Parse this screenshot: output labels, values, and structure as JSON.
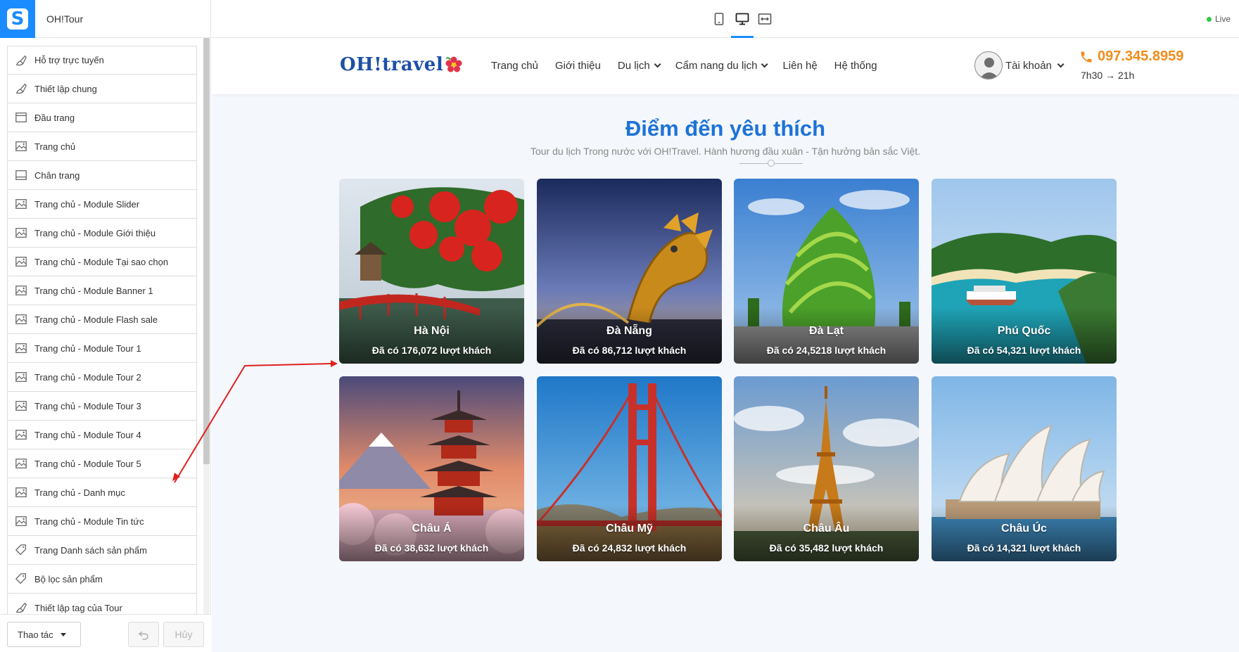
{
  "sidebar": {
    "site_name": "OH!Tour",
    "items": [
      {
        "label": "Hỗ trợ trực tuyến",
        "icon": "brush-icon"
      },
      {
        "label": "Thiết lập chung",
        "icon": "brush-icon"
      },
      {
        "label": "Đầu trang",
        "icon": "header-layout-icon"
      },
      {
        "label": "Trang chủ",
        "icon": "image-icon"
      },
      {
        "label": "Chân trang",
        "icon": "footer-layout-icon"
      },
      {
        "label": "Trang chủ - Module Slider",
        "icon": "image-icon"
      },
      {
        "label": "Trang chủ - Module Giới thiệu",
        "icon": "image-icon"
      },
      {
        "label": "Trang chủ - Module Tại sao chọn",
        "icon": "image-icon"
      },
      {
        "label": "Trang chủ - Module Banner 1",
        "icon": "image-icon"
      },
      {
        "label": "Trang chủ - Module Flash sale",
        "icon": "image-icon"
      },
      {
        "label": "Trang chủ - Module Tour 1",
        "icon": "image-icon"
      },
      {
        "label": "Trang chủ - Module Tour 2",
        "icon": "image-icon"
      },
      {
        "label": "Trang chủ - Module Tour 3",
        "icon": "image-icon"
      },
      {
        "label": "Trang chủ - Module Tour 4",
        "icon": "image-icon"
      },
      {
        "label": "Trang chủ - Module Tour 5",
        "icon": "image-icon"
      },
      {
        "label": "Trang chủ - Danh mục",
        "icon": "image-icon"
      },
      {
        "label": "Trang chủ - Module Tin tức",
        "icon": "image-icon"
      },
      {
        "label": "Trang Danh sách sản phẩm",
        "icon": "tag-icon"
      },
      {
        "label": "Bộ lọc sản phẩm",
        "icon": "tag-icon"
      },
      {
        "label": "Thiết lập tag của Tour",
        "icon": "brush-icon"
      }
    ],
    "actions_label": "Thao tác",
    "cancel_label": "Hủy"
  },
  "toolbar": {
    "live_label": "Live",
    "live_color": "#2ecc40",
    "accent": "#1a8cff"
  },
  "site": {
    "brand": "OH!travel",
    "nav": [
      {
        "label": "Trang chủ",
        "dropdown": false
      },
      {
        "label": "Giới thiệu",
        "dropdown": false
      },
      {
        "label": "Du lịch",
        "dropdown": true
      },
      {
        "label": "Cẩm nang du lịch",
        "dropdown": true
      },
      {
        "label": "Liên hệ",
        "dropdown": false
      },
      {
        "label": "Hệ thống",
        "dropdown": false
      }
    ],
    "account_label": "Tài khoản",
    "phone": "097.345.8959",
    "hours": "7h30 → 21h",
    "phone_color": "#f08c1a"
  },
  "section": {
    "title": "Điểm đến yêu thích",
    "subtitle": "Tour du lịch Trong nước với OH!Travel. Hành hương đầu xuân - Tận hưởng bản sắc Việt.",
    "title_color": "#1d73d6"
  },
  "destinations": [
    {
      "name": "Hà Nội",
      "count": "Đã có 176,072 lượt khách"
    },
    {
      "name": "Đà Nẵng",
      "count": "Đã có 86,712 lượt khách"
    },
    {
      "name": "Đà Lạt",
      "count": "Đã có 24,5218 lượt khách"
    },
    {
      "name": "Phú Quốc",
      "count": "Đã có 54,321 lượt khách"
    },
    {
      "name": "Châu Á",
      "count": "Đã có 38,632 lượt khách"
    },
    {
      "name": "Châu Mỹ",
      "count": "Đã có 24,832 lượt khách"
    },
    {
      "name": "Châu Âu",
      "count": "Đã có 35,482 lượt khách"
    },
    {
      "name": "Châu Úc",
      "count": "Đã có 14,321 lượt khách"
    }
  ]
}
